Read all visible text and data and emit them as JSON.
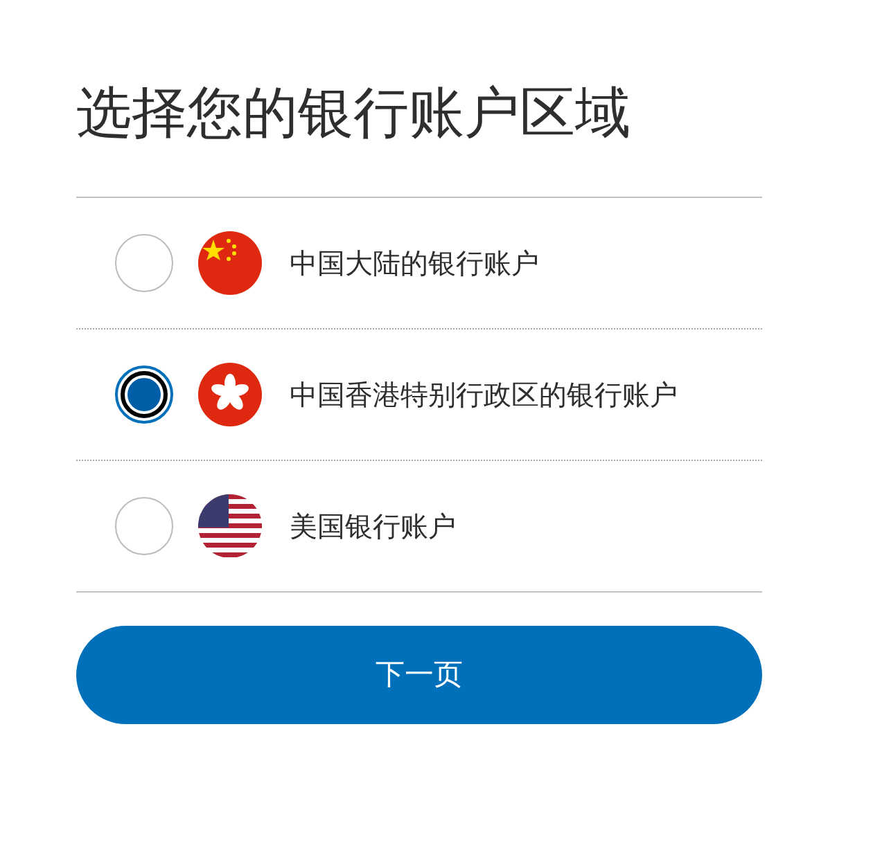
{
  "title": "选择您的银行账户区域",
  "options": [
    {
      "label": "中国大陆的银行账户",
      "kind": "cn",
      "selected": false
    },
    {
      "label": "中国香港特别行政区的银行账户",
      "kind": "hk",
      "selected": true
    },
    {
      "label": "美国银行账户",
      "kind": "us",
      "selected": false
    }
  ],
  "next_button": "下一页"
}
